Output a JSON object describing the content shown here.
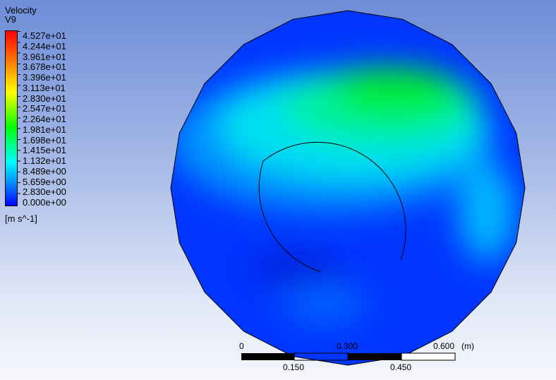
{
  "legend": {
    "title": "Velocity",
    "subtitle": "V9",
    "labels": [
      "4.527e+01",
      "4.244e+01",
      "3.961e+01",
      "3.678e+01",
      "3.396e+01",
      "3.113e+01",
      "2.830e+01",
      "2.547e+01",
      "2.264e+01",
      "1.981e+01",
      "1.698e+01",
      "1.415e+01",
      "1.132e+01",
      "8.489e+00",
      "5.659e+00",
      "2.830e+00",
      "0.000e+00"
    ],
    "units": "[m s^-1]"
  },
  "scale": {
    "labels_top": [
      "0",
      "0.300",
      "0.600"
    ],
    "labels_bottom": [
      "0.150",
      "0.450"
    ],
    "unit": "(m)"
  }
}
